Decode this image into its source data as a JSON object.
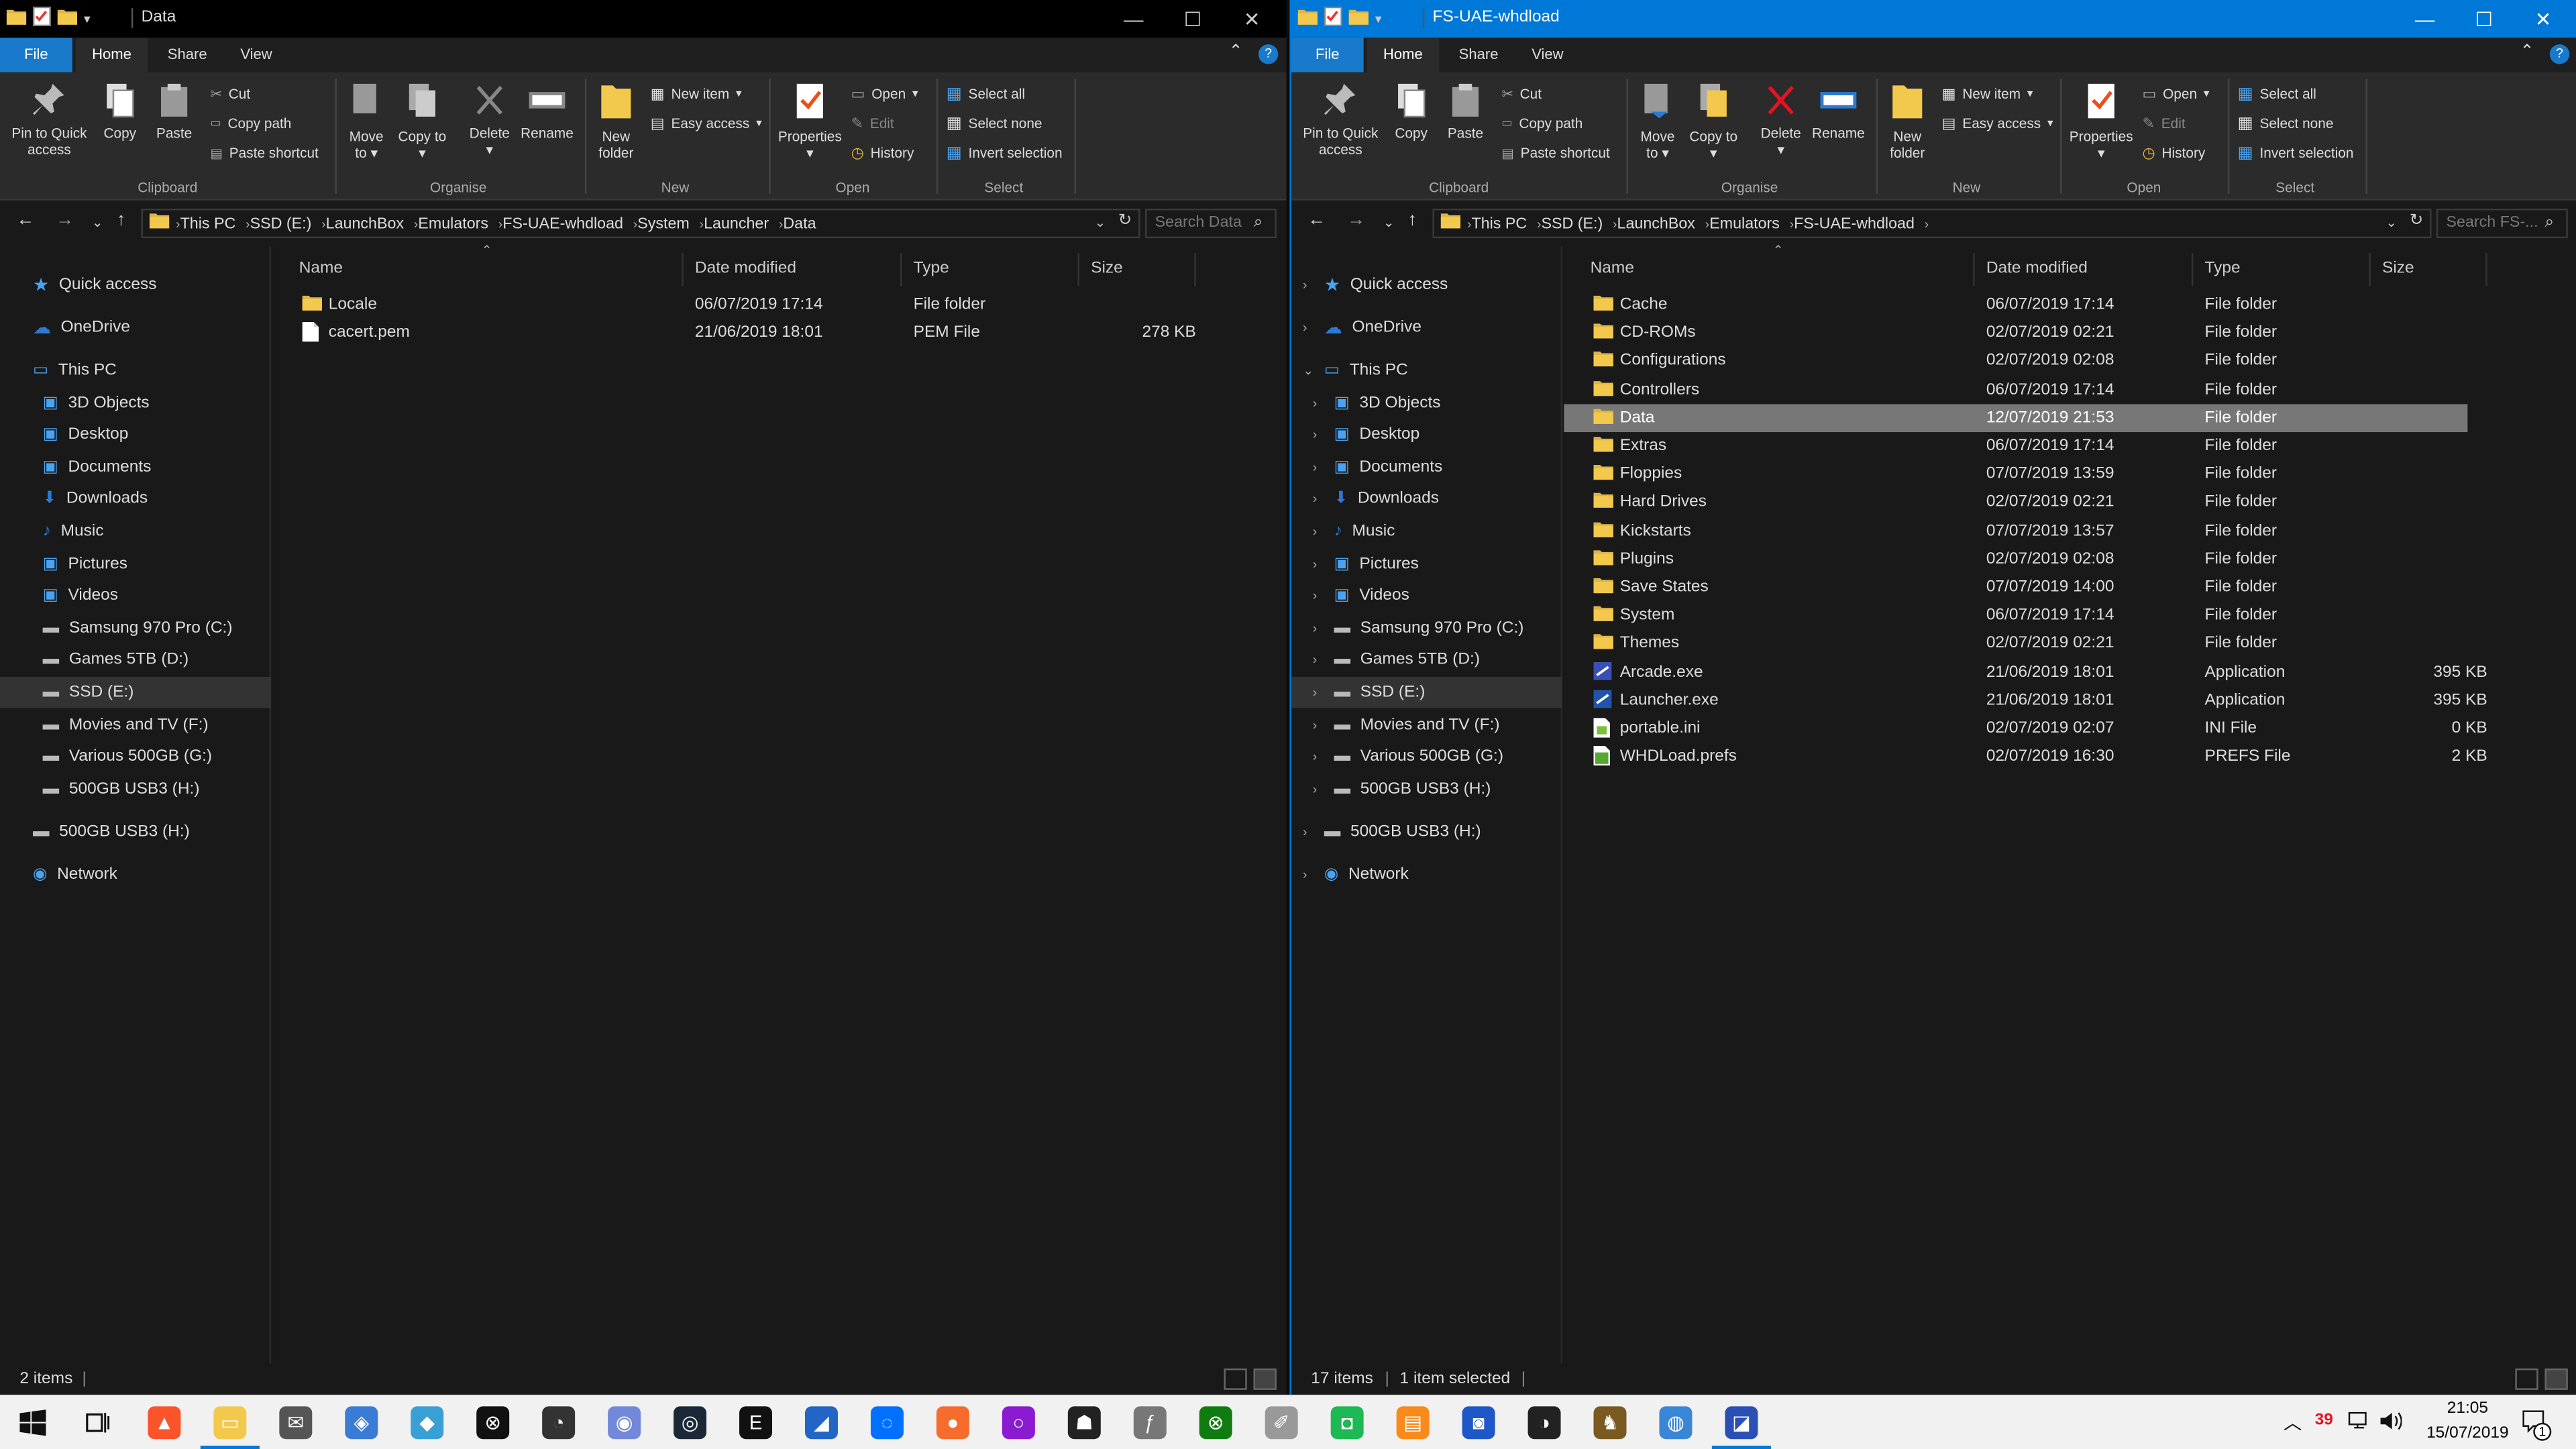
{
  "left": {
    "title": "Data",
    "tabs": [
      "File",
      "Home",
      "Share",
      "View"
    ],
    "ribbon": {
      "pin": "Pin to Quick access",
      "copy": "Copy",
      "paste": "Paste",
      "cut": "Cut",
      "copy_path": "Copy path",
      "paste_shortcut": "Paste shortcut",
      "move_to": "Move to",
      "copy_to": "Copy to",
      "delete": "Delete",
      "rename": "Rename",
      "new_folder": "New folder",
      "new_item": "New item",
      "easy_access": "Easy access",
      "properties": "Properties",
      "open": "Open",
      "edit": "Edit",
      "history": "History",
      "select_all": "Select all",
      "select_none": "Select none",
      "invert_selection": "Invert selection",
      "groups": [
        "Clipboard",
        "Organise",
        "New",
        "Open",
        "Select"
      ]
    },
    "breadcrumb": [
      "This PC",
      "SSD (E:)",
      "LaunchBox",
      "Emulators",
      "FS-UAE-whdload",
      "System",
      "Launcher",
      "Data"
    ],
    "search_placeholder": "Search Data",
    "sidebar": [
      "Quick access",
      "OneDrive",
      "This PC",
      "3D Objects",
      "Desktop",
      "Documents",
      "Downloads",
      "Music",
      "Pictures",
      "Videos",
      "Samsung 970 Pro (C:)",
      "Games 5TB (D:)",
      "SSD (E:)",
      "Movies and TV (F:)",
      "Various 500GB (G:)",
      "500GB USB3 (H:)",
      "500GB USB3 (H:)",
      "Network"
    ],
    "columns": [
      "Name",
      "Date modified",
      "Type",
      "Size"
    ],
    "files": [
      {
        "name": "Locale",
        "date": "06/07/2019 17:14",
        "type": "File folder",
        "size": "",
        "icon": "folder"
      },
      {
        "name": "cacert.pem",
        "date": "21/06/2019 18:01",
        "type": "PEM File",
        "size": "278 KB",
        "icon": "file"
      }
    ],
    "status": "2 items"
  },
  "right": {
    "title": "FS-UAE-whdload",
    "tabs": [
      "File",
      "Home",
      "Share",
      "View"
    ],
    "breadcrumb": [
      "This PC",
      "SSD (E:)",
      "LaunchBox",
      "Emulators",
      "FS-UAE-whdload"
    ],
    "search_placeholder": "Search FS-...",
    "sidebar": [
      "Quick access",
      "OneDrive",
      "This PC",
      "3D Objects",
      "Desktop",
      "Documents",
      "Downloads",
      "Music",
      "Pictures",
      "Videos",
      "Samsung 970 Pro (C:)",
      "Games 5TB (D:)",
      "SSD (E:)",
      "Movies and TV (F:)",
      "Various 500GB (G:)",
      "500GB USB3 (H:)",
      "500GB USB3 (H:)",
      "Network"
    ],
    "columns": [
      "Name",
      "Date modified",
      "Type",
      "Size"
    ],
    "files": [
      {
        "name": "Cache",
        "date": "06/07/2019 17:14",
        "type": "File folder",
        "size": "",
        "icon": "folder"
      },
      {
        "name": "CD-ROMs",
        "date": "02/07/2019 02:21",
        "type": "File folder",
        "size": "",
        "icon": "folder"
      },
      {
        "name": "Configurations",
        "date": "02/07/2019 02:08",
        "type": "File folder",
        "size": "",
        "icon": "folder"
      },
      {
        "name": "Controllers",
        "date": "06/07/2019 17:14",
        "type": "File folder",
        "size": "",
        "icon": "folder"
      },
      {
        "name": "Data",
        "date": "12/07/2019 21:53",
        "type": "File folder",
        "size": "",
        "icon": "folder"
      },
      {
        "name": "Extras",
        "date": "06/07/2019 17:14",
        "type": "File folder",
        "size": "",
        "icon": "folder"
      },
      {
        "name": "Floppies",
        "date": "07/07/2019 13:59",
        "type": "File folder",
        "size": "",
        "icon": "folder"
      },
      {
        "name": "Hard Drives",
        "date": "02/07/2019 02:21",
        "type": "File folder",
        "size": "",
        "icon": "folder"
      },
      {
        "name": "Kickstarts",
        "date": "07/07/2019 13:57",
        "type": "File folder",
        "size": "",
        "icon": "folder"
      },
      {
        "name": "Plugins",
        "date": "02/07/2019 02:08",
        "type": "File folder",
        "size": "",
        "icon": "folder"
      },
      {
        "name": "Save States",
        "date": "07/07/2019 14:00",
        "type": "File folder",
        "size": "",
        "icon": "folder"
      },
      {
        "name": "System",
        "date": "06/07/2019 17:14",
        "type": "File folder",
        "size": "",
        "icon": "folder"
      },
      {
        "name": "Themes",
        "date": "02/07/2019 02:21",
        "type": "File folder",
        "size": "",
        "icon": "folder"
      },
      {
        "name": "Arcade.exe",
        "date": "21/06/2019 18:01",
        "type": "Application",
        "size": "395 KB",
        "icon": "app"
      },
      {
        "name": "Launcher.exe",
        "date": "21/06/2019 18:01",
        "type": "Application",
        "size": "395 KB",
        "icon": "app"
      },
      {
        "name": "portable.ini",
        "date": "02/07/2019 02:07",
        "type": "INI File",
        "size": "0 KB",
        "icon": "ini"
      },
      {
        "name": "WHDLoad.prefs",
        "date": "02/07/2019 16:30",
        "type": "PREFS File",
        "size": "2 KB",
        "icon": "prefs"
      }
    ],
    "status": "17 items",
    "status_sel": "1 item selected"
  },
  "taskbar": {
    "time": "21:05",
    "date": "15/07/2019",
    "badge": "39",
    "notification_count": "1"
  }
}
